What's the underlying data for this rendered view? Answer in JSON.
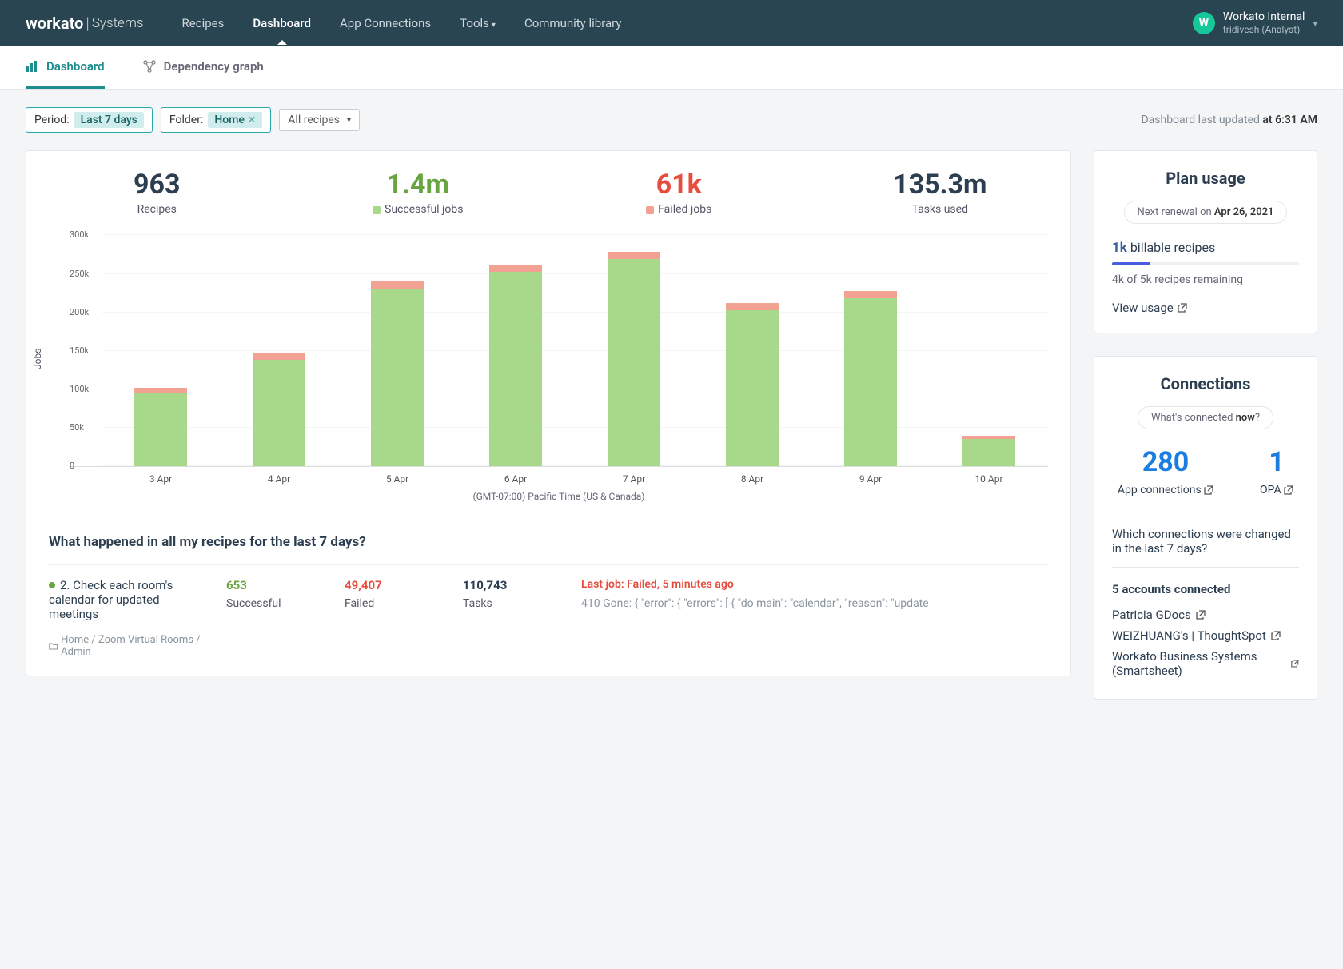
{
  "brand": {
    "main": "workato",
    "sub": "Systems"
  },
  "topnav": [
    "Recipes",
    "Dashboard",
    "App Connections",
    "Tools",
    "Community library"
  ],
  "user": {
    "avatar_letter": "W",
    "name": "Workato Internal",
    "sub": "tridivesh  (Analyst)"
  },
  "subtabs": {
    "dashboard": "Dashboard",
    "dep": "Dependency graph"
  },
  "filters": {
    "period_label": "Period:",
    "period_value": "Last 7 days",
    "folder_label": "Folder:",
    "folder_value": "Home",
    "recipes": "All recipes"
  },
  "updated": {
    "prefix": "Dashboard last updated ",
    "time": "at 6:31 AM"
  },
  "metrics": {
    "recipes": {
      "num": "963",
      "label": "Recipes"
    },
    "success": {
      "num": "1.4m",
      "label": "Successful jobs"
    },
    "failed": {
      "num": "61k",
      "label": "Failed jobs"
    },
    "tasks": {
      "num": "135.3m",
      "label": "Tasks used"
    }
  },
  "chart_data": {
    "type": "bar",
    "ylabel": "Jobs",
    "categories": [
      "3 Apr",
      "4 Apr",
      "5 Apr",
      "6 Apr",
      "7 Apr",
      "8 Apr",
      "9 Apr",
      "10 Apr"
    ],
    "series": [
      {
        "name": "Successful jobs",
        "values": [
          95000,
          138000,
          230000,
          252000,
          268000,
          202000,
          218000,
          36000
        ]
      },
      {
        "name": "Failed jobs",
        "values": [
          7000,
          9000,
          10000,
          9000,
          10000,
          9000,
          9000,
          4000
        ]
      }
    ],
    "ylim": [
      0,
      300000
    ],
    "yticks": [
      0,
      50000,
      100000,
      150000,
      200000,
      250000,
      300000
    ],
    "ytick_labels": [
      "0",
      "50k",
      "100k",
      "150k",
      "200k",
      "250k",
      "300k"
    ],
    "timezone": "(GMT-07:00) Pacific Time (US & Canada)"
  },
  "activity": {
    "title": "What happened in all my recipes for the last 7 days?",
    "rows": [
      {
        "name": "2. Check each room's calendar for updated meetings",
        "path": "Home / Zoom Virtual Rooms / Admin",
        "successful": {
          "v": "653",
          "l": "Successful"
        },
        "failed": {
          "v": "49,407",
          "l": "Failed"
        },
        "tasks": {
          "v": "110,743",
          "l": "Tasks"
        },
        "last_job_header": "Last job: Failed, 5 minutes ago",
        "last_job_msg": "410 Gone: { \"error\": { \"errors\": [ { \"do main\": \"calendar\", \"reason\": \"update"
      }
    ]
  },
  "plan": {
    "title": "Plan usage",
    "renewal_prefix": "Next renewal on ",
    "renewal_date": "Apr 26, 2021",
    "billable_num": "1k",
    "billable_label": " billable recipes",
    "remaining": "4k of 5k recipes remaining",
    "progress_pct": 20,
    "view": "View usage"
  },
  "connections": {
    "title": "Connections",
    "pill_prefix": "What's connected ",
    "pill_bold": "now",
    "pill_suffix": "?",
    "apps": {
      "num": "280",
      "label": "App connections"
    },
    "opa": {
      "num": "1",
      "label": "OPA"
    },
    "question": "Which connections were changed in the last 7 days?",
    "accounts_title": "5 accounts connected",
    "accounts": [
      "Patricia GDocs",
      "WEIZHUANG's | ThoughtSpot",
      "Workato Business Systems (Smartsheet)"
    ]
  }
}
